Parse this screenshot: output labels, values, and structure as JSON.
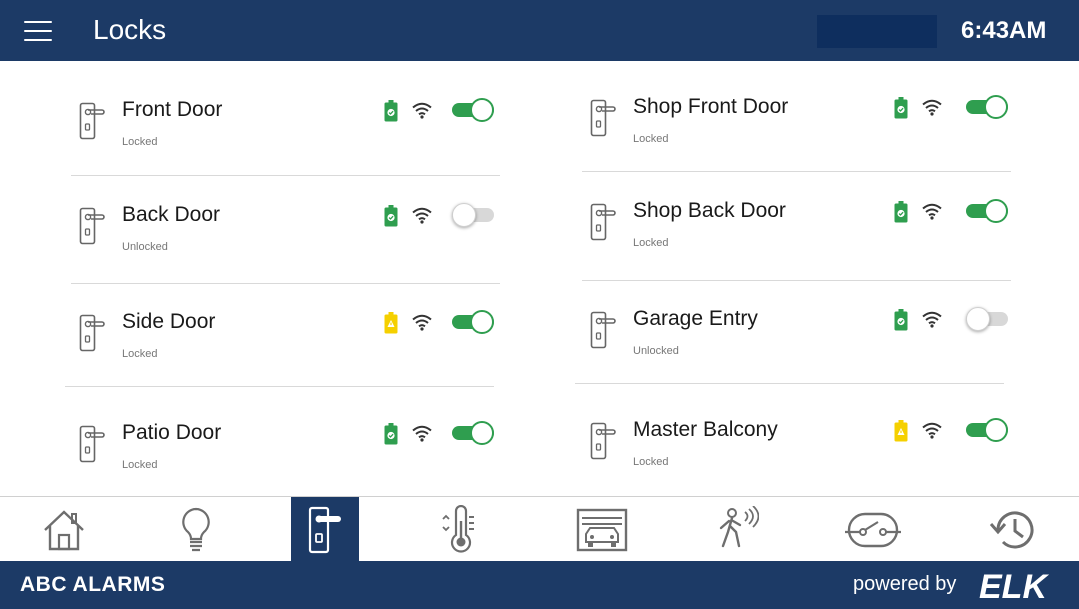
{
  "header": {
    "title": "Locks",
    "time": "6:43AM"
  },
  "colors": {
    "navy": "#1c3a66",
    "green": "#2f9e4f",
    "yellow": "#f5d000",
    "gray_icon": "#666666"
  },
  "locks_left": [
    {
      "name": "Front Door",
      "status": "Locked",
      "battery": "ok",
      "locked": true
    },
    {
      "name": "Back Door",
      "status": "Unlocked",
      "battery": "ok",
      "locked": false
    },
    {
      "name": "Side Door",
      "status": "Locked",
      "battery": "low",
      "locked": true
    },
    {
      "name": "Patio Door",
      "status": "Locked",
      "battery": "ok",
      "locked": true
    }
  ],
  "locks_right": [
    {
      "name": "Shop Front Door",
      "status": "Locked",
      "battery": "ok",
      "locked": true
    },
    {
      "name": "Shop Back Door",
      "status": "Locked",
      "battery": "ok",
      "locked": true
    },
    {
      "name": "Garage Entry",
      "status": "Unlocked",
      "battery": "ok",
      "locked": false
    },
    {
      "name": "Master Balcony",
      "status": "Locked",
      "battery": "low",
      "locked": true
    }
  ],
  "tabs": [
    {
      "icon": "home-icon",
      "active": false
    },
    {
      "icon": "lightbulb-icon",
      "active": false
    },
    {
      "icon": "door-lock-icon",
      "active": true
    },
    {
      "icon": "thermostat-icon",
      "active": false
    },
    {
      "icon": "garage-icon",
      "active": false
    },
    {
      "icon": "motion-sensor-icon",
      "active": false
    },
    {
      "icon": "switch-icon",
      "active": false
    },
    {
      "icon": "history-icon",
      "active": false
    }
  ],
  "footer": {
    "brand": "ABC ALARMS",
    "powered_by": "powered by",
    "logo": "ELK"
  }
}
